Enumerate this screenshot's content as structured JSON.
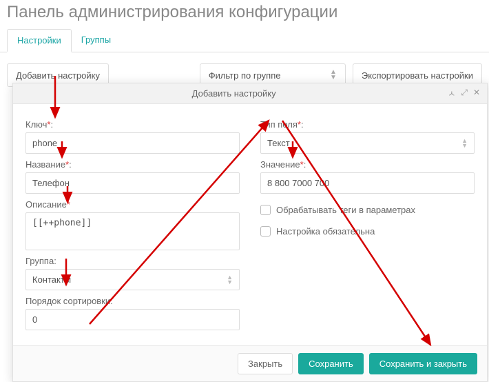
{
  "page": {
    "title": "Панель администрирования конфигурации"
  },
  "tabs": {
    "settings": "Настройки",
    "groups": "Группы"
  },
  "toolbar": {
    "add": "Добавить настройку",
    "filter_placeholder": "Фильтр по группе",
    "export": "Экспортировать настройки"
  },
  "modal": {
    "title": "Добавить настройку",
    "labels": {
      "key": "Ключ",
      "name": "Название",
      "description": "Описание",
      "group": "Группа:",
      "sort": "Порядок сортировки:",
      "field_type": "Тип поля",
      "value": "Значение",
      "process_tags": "Обрабатывать теги в параметрах",
      "required": "Настройка обязательна"
    },
    "values": {
      "key": "phone",
      "name": "Телефон",
      "description": "[[++phone]]",
      "group": "Контакты",
      "sort": "0",
      "field_type": "Текст",
      "value": "8 800 7000 700"
    },
    "footer": {
      "close": "Закрыть",
      "save": "Сохранить",
      "save_close": "Сохранить и закрыть"
    }
  }
}
